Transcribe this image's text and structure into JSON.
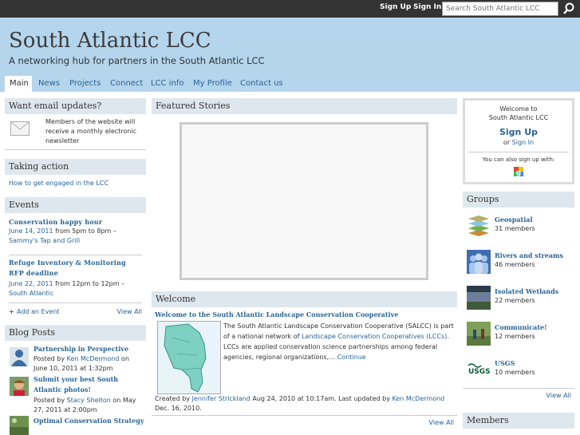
{
  "topbar": {
    "signup": "Sign Up",
    "signin": "Sign In",
    "search_placeholder": "Search South Atlantic LCC"
  },
  "header": {
    "title": "South Atlantic LCC",
    "tagline": "A networking hub for partners in the South Atlantic LCC"
  },
  "nav": [
    "Main",
    "News",
    "Projects",
    "Connect",
    "LCC info",
    "My Profile",
    "Contact us"
  ],
  "left": {
    "email": {
      "title": "Want email updates?",
      "text": "Members of the website will receive a monthly electronic newsletter"
    },
    "action": {
      "title": "Taking action",
      "link": "How to get engaged in the LCC"
    },
    "events": {
      "title": "Events",
      "items": [
        {
          "title": "Conservation happy hour",
          "date": "June 14, 2011",
          "mid": " from 5pm to 8pm – ",
          "place": "Sammy's Tap and Grill"
        },
        {
          "title": "Refuge Inventory & Monitoring RFP deadline",
          "date": "June 22, 2011",
          "mid": " from 12pm to 12pm – ",
          "place": "South Atlantic"
        }
      ],
      "add": "Add an Event",
      "view_all": "View All"
    },
    "blog": {
      "title": "Blog Posts",
      "posts": [
        {
          "title": "Partnership in Perspective",
          "pre": "Posted by ",
          "author": "Ken McDermond",
          "post": " on June 10, 2011 at 1:32pm"
        },
        {
          "title": "Submit your best South Atlantic photos!",
          "pre": "Posted by ",
          "author": "Stacy Shelton",
          "post": " on May 27, 2011 at 2:00pm"
        },
        {
          "title": "Optimal Conservation Strategy"
        }
      ]
    }
  },
  "mid": {
    "featured": {
      "title": "Featured Stories"
    },
    "welcome": {
      "title": "Welcome",
      "link": "Welcome to the South Atlantic Landscape Conservation Cooperative",
      "body1": "The South Atlantic Landscape Conservation Cooperative (SALCC) is part of a national network of ",
      "body_link": "Landscape Conservation Cooperatives (LCCs)",
      "body2": ". LCCs are applied conservation science partnerships among federal agencies, regional organizations,… ",
      "continue": "Continue",
      "created_pre": "Created by ",
      "created_by": "Jennifer Strickland",
      "created_mid": " Aug 24, 2010 at 10:17am. Last updated by ",
      "updated_by": "Ken McDermond",
      "created_post": " Dec. 16, 2010.",
      "view_all": "View All"
    }
  },
  "right": {
    "welcome": {
      "line1": "Welcome to",
      "line2": "South Atlantic LCC",
      "signup": "Sign Up",
      "or": "or ",
      "signin": "Sign In",
      "also": "You can also sign up with:"
    },
    "groups": {
      "title": "Groups",
      "items": [
        {
          "name": "Geospatial",
          "members": "31 members"
        },
        {
          "name": "Rivers and streams",
          "members": "46 members"
        },
        {
          "name": "Isolated Wetlands",
          "members": "22 members"
        },
        {
          "name": "Communicate!",
          "members": "12 members"
        },
        {
          "name": "USGS",
          "members": "10 members"
        }
      ],
      "view_all": "View All",
      "usgs_logo": "USGS"
    },
    "members": {
      "title": "Members"
    }
  }
}
